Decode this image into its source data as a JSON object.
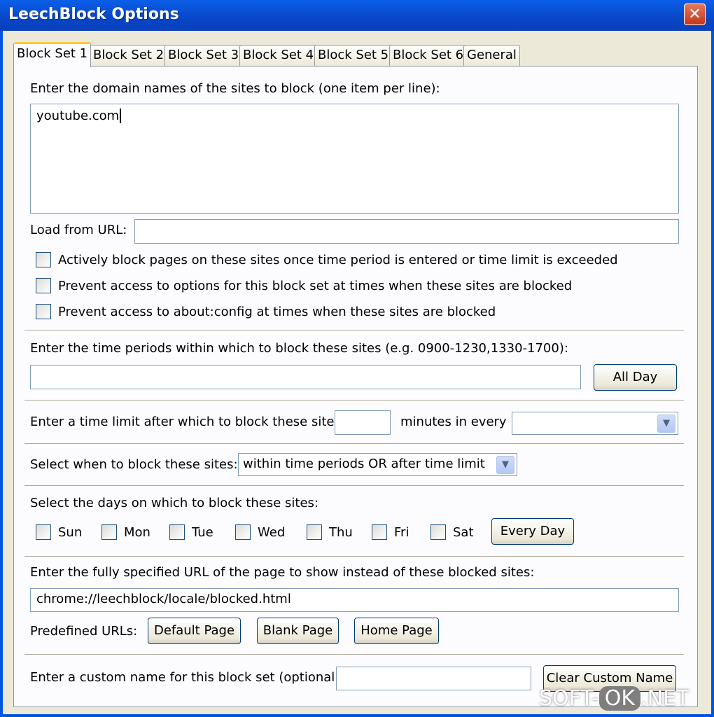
{
  "window": {
    "title": "LeechBlock Options",
    "close_glyph": "✕"
  },
  "tabs": [
    "Block Set 1",
    "Block Set 2",
    "Block Set 3",
    "Block Set 4",
    "Block Set 5",
    "Block Set 6",
    "General"
  ],
  "sites": {
    "label": "Enter the domain names of the sites to block (one item per line):",
    "value": "youtube.com",
    "load_url_label": "Load from URL:",
    "load_url_value": ""
  },
  "options": [
    {
      "label": "Actively block pages on these sites once time period is entered or time limit is exceeded",
      "checked": false
    },
    {
      "label": "Prevent access to options for this block set at times when these sites are blocked",
      "checked": false
    },
    {
      "label": "Prevent access to about:config at times when these sites are blocked",
      "checked": false
    }
  ],
  "time_periods": {
    "label": "Enter the time periods within which to block these sites (e.g. 0900-1230,1330-1700):",
    "value": "",
    "all_day_button": "All Day"
  },
  "time_limit": {
    "label": "Enter a time limit after which to block these sites:",
    "minutes_value": "",
    "minutes_label": "minutes in every",
    "period_value": ""
  },
  "block_mode": {
    "label": "Select when to block these sites:",
    "value": "within time periods OR after time limit"
  },
  "days": {
    "label": "Select the days on which to block these sites:",
    "items": [
      "Sun",
      "Mon",
      "Tue",
      "Wed",
      "Thu",
      "Fri",
      "Sat"
    ],
    "every_day_button": "Every Day"
  },
  "redirect": {
    "label": "Enter the fully specified URL of the page to show instead of these blocked sites:",
    "value": "chrome://leechblock/locale/blocked.html",
    "predefined_label": "Predefined URLs:",
    "buttons": [
      "Default Page",
      "Blank Page",
      "Home Page"
    ]
  },
  "custom_name": {
    "label": "Enter a custom name for this block set (optional):",
    "value": "",
    "clear_button": "Clear Custom Name"
  },
  "watermark": {
    "left": "SOFT-",
    "ok": "OK",
    "right": ".NET"
  },
  "icons": {
    "dropdown": "chevron-down-icon",
    "close": "close-icon"
  }
}
